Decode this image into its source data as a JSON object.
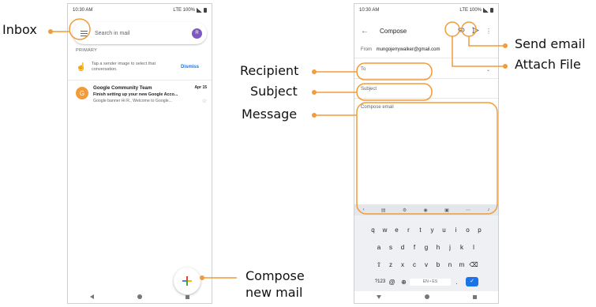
{
  "inbox_screen": {
    "status_time": "10:30 AM",
    "status_right": "LTE  100%",
    "search_placeholder": "Search in mail",
    "avatar_letter": "R",
    "section_label": "PRIMARY",
    "tip_text": "Tap a sender image to select that conversation.",
    "dismiss_label": "Dismiss",
    "email": {
      "avatar_letter": "G",
      "sender": "Google Community Team",
      "date": "Apr 15",
      "subject": "Finish setting up your new Google Acco...",
      "snippet": "Google banner Hi R., Welcome to Google..."
    }
  },
  "compose_screen": {
    "status_time": "10:30 AM",
    "status_right": "LTE  100%",
    "title": "Compose",
    "from_label": "From",
    "from_address": "mungojerrywalker@gmail.com",
    "to_label": "To",
    "subject_placeholder": "Subject",
    "body_placeholder": "Compose email",
    "keyboard": {
      "row1": [
        "q",
        "w",
        "e",
        "r",
        "t",
        "y",
        "u",
        "i",
        "o",
        "p"
      ],
      "row2": [
        "a",
        "s",
        "d",
        "f",
        "g",
        "h",
        "j",
        "k",
        "l"
      ],
      "row3": [
        "z",
        "x",
        "c",
        "v",
        "b",
        "n",
        "m"
      ],
      "num_key": "?123",
      "at_key": "@",
      "space_label": "EN • ES",
      "period_key": "."
    }
  },
  "annotations": {
    "inbox": "Inbox",
    "recipient": "Recipient",
    "subject": "Subject",
    "message": "Message",
    "send_email": "Send email",
    "attach_file": "Attach File",
    "compose_new_mail_line1": "Compose",
    "compose_new_mail_line2": "new mail"
  },
  "colors": {
    "annotation": "#f29b38",
    "accent": "#1a73e8"
  }
}
